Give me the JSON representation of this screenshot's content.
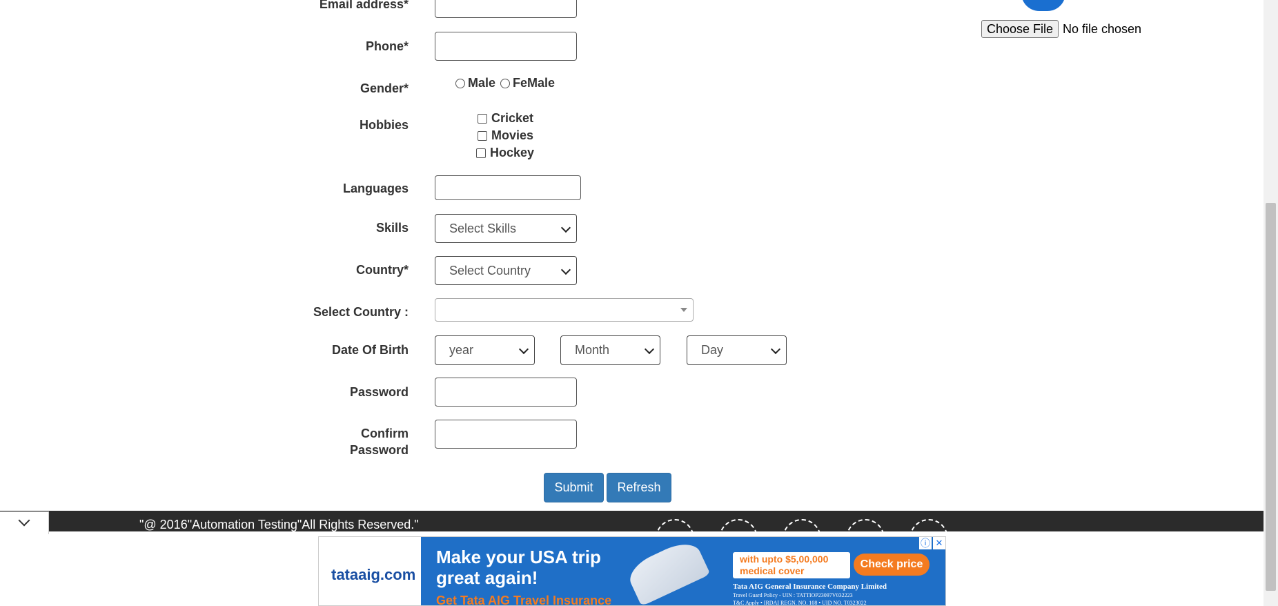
{
  "form": {
    "email_label": "Email address*",
    "phone_label": "Phone*",
    "gender_label": "Gender*",
    "gender_options": [
      "Male",
      "FeMale"
    ],
    "hobbies_label": "Hobbies",
    "hobbies": [
      "Cricket",
      "Movies",
      "Hockey"
    ],
    "languages_label": "Languages",
    "skills_label": "Skills",
    "skills_placeholder": "Select Skills",
    "country_label": "Country*",
    "country_placeholder": "Select Country",
    "select_country_label": "Select Country :",
    "dob_label": "Date Of Birth",
    "dob_year": "year",
    "dob_month": "Month",
    "dob_day": "Day",
    "password_label": "Password",
    "confirm_password_label_1": "Confirm",
    "confirm_password_label_2": "Password",
    "submit_label": "Submit",
    "refresh_label": "Refresh"
  },
  "file_upload": {
    "button_label": "Choose File",
    "status_text": "No file chosen"
  },
  "footer": {
    "copyright": "\"@ 2016\"Automation Testing\"All Rights Reserved.\""
  },
  "ad": {
    "brand": "tataaig.com",
    "headline_1": "Make your USA trip",
    "headline_2": "great again!",
    "subline": "Get Tata AIG Travel Insurance",
    "offer_1": "with upto $5,00,000",
    "offer_2": "medical cover",
    "cta": "Check price",
    "company": "Tata AIG General Insurance Company Limited",
    "policy": "Travel Guard Policy - UIN : TATTIOP23097V032223",
    "legal": "T&C Apply • IRDAI REGN. NO. 108 • UID NO. T0323022",
    "info_icon": "ⓘ",
    "close_icon": "✕"
  },
  "colors": {
    "primary_button": "#337ab7",
    "footer_bg": "#2b2b2b",
    "ad_blue": "#1f6fc7",
    "ad_orange": "#f47b20"
  }
}
